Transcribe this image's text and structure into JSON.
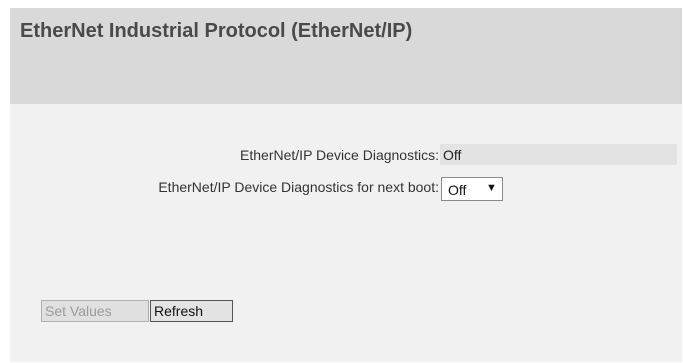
{
  "header": {
    "title": "EtherNet Industrial Protocol (EtherNet/IP)"
  },
  "form": {
    "diagnostics_label": "EtherNet/IP Device Diagnostics:",
    "diagnostics_value": "Off",
    "next_boot_label": "EtherNet/IP Device Diagnostics for next boot:",
    "next_boot_selected": "Off"
  },
  "buttons": {
    "set_values": "Set Values",
    "refresh": "Refresh"
  },
  "icons": {
    "dropdown_arrow": "▼"
  }
}
